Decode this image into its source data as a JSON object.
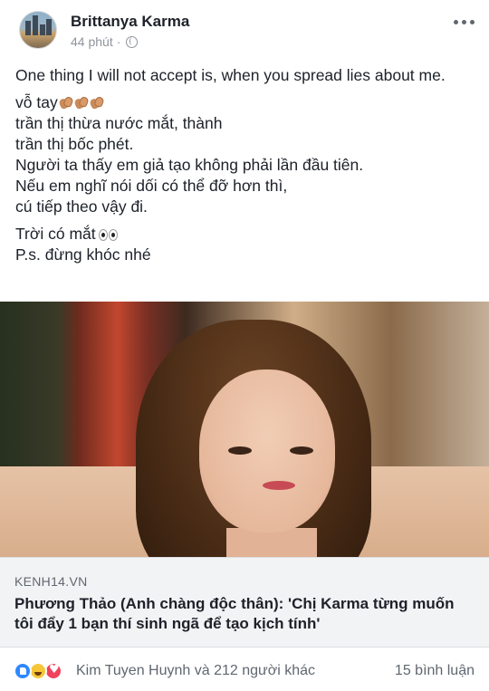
{
  "post": {
    "author": "Brittanya Karma",
    "time": "44 phút",
    "privacy_icon": "globe-icon",
    "text": {
      "line1": "One thing I will not accept is, when you spread lies about me.",
      "line2": "vỗ tay",
      "line3": "trần thị thừa nước mắt, thành",
      "line4": "trần thị bốc phét.",
      "line5": "Người ta thấy em giả tạo không phải lần đầu tiên.",
      "line6": "Nếu em nghĩ nói dối có thể đỡ hơn thì,",
      "line7": "cú tiếp theo vậy đi.",
      "line8": "Trời có mắt",
      "line9": "P.s. đừng khóc nhé"
    }
  },
  "link": {
    "domain": "KENH14.VN",
    "headline": "Phương Thảo (Anh chàng độc thân): 'Chị Karma từng muốn tôi đẩy 1 bạn thí sinh ngã để tạo kịch tính'"
  },
  "footer": {
    "reaction_icons": [
      "like-icon",
      "haha-icon",
      "love-icon"
    ],
    "reactions_text": "Kim Tuyen Huynh và 212 người khác",
    "comments_text": "15 bình luận"
  }
}
